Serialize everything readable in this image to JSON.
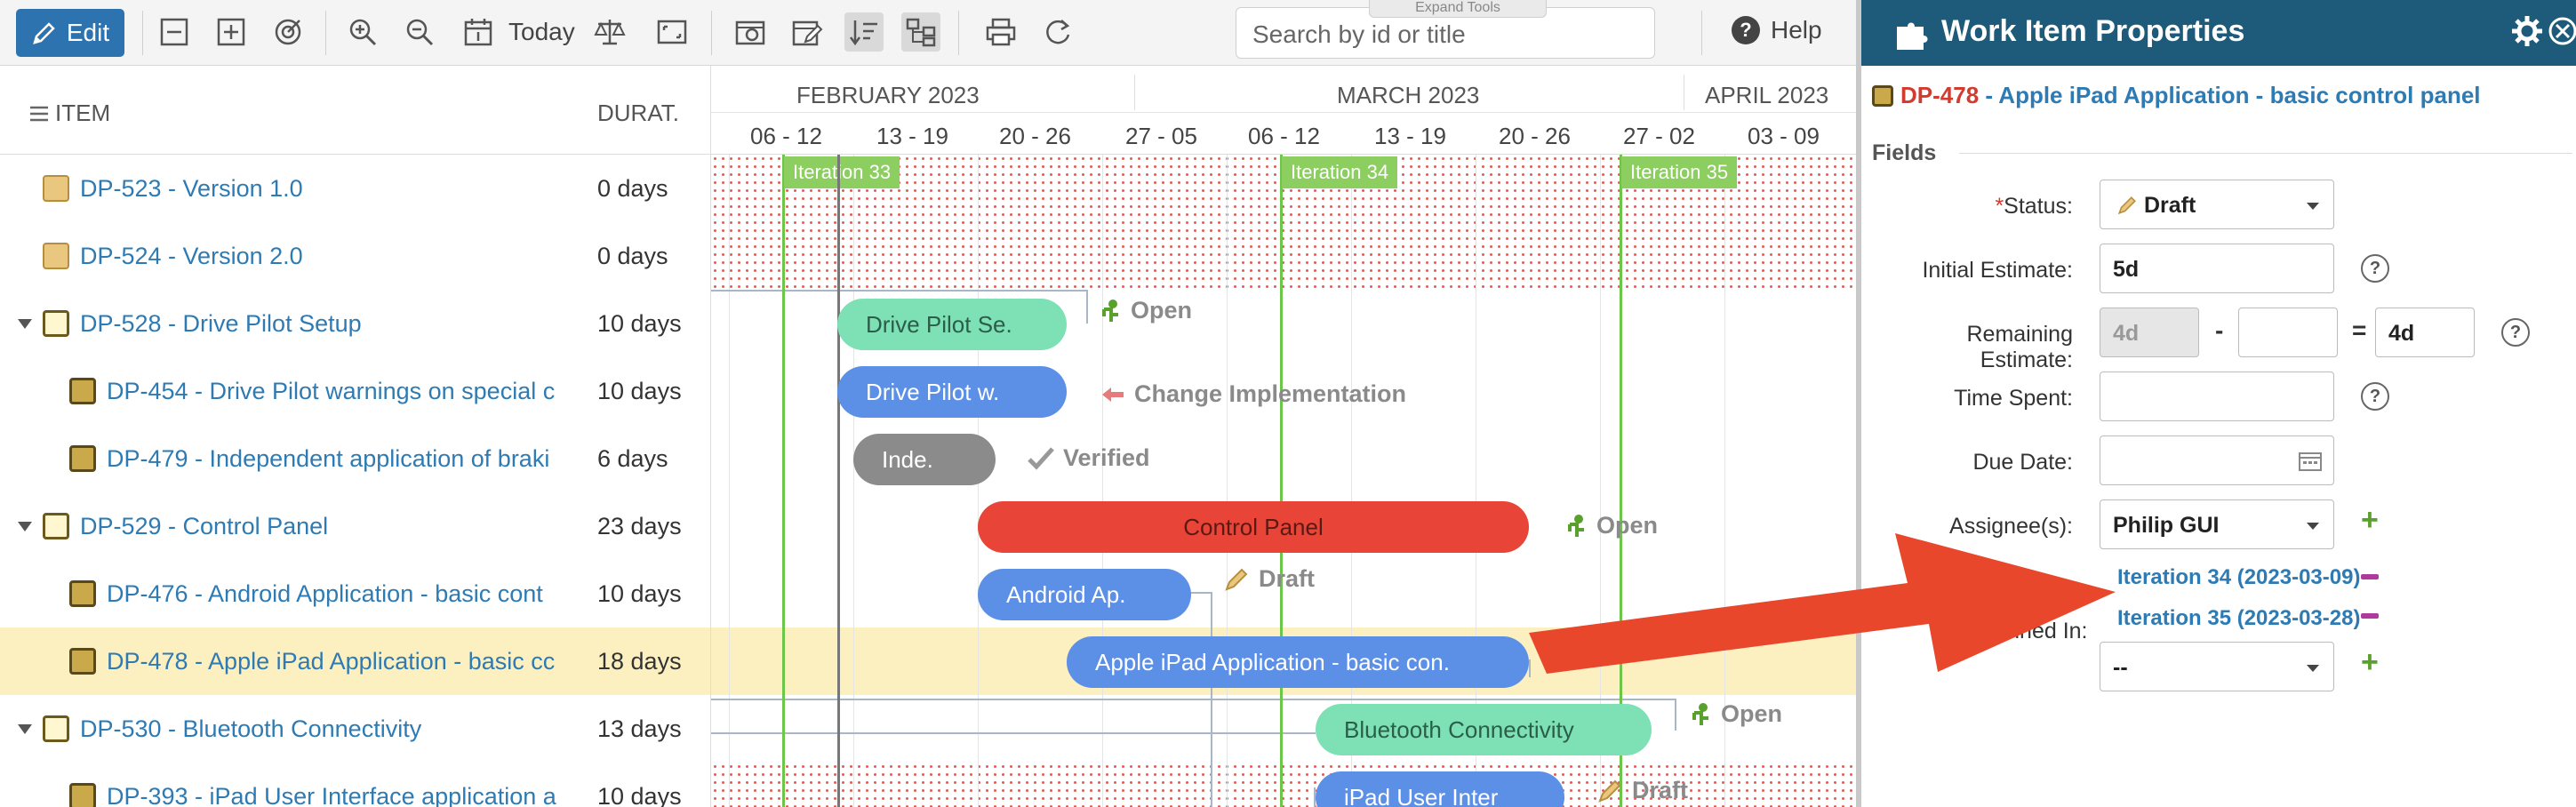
{
  "toolbar": {
    "edit_label": "Edit",
    "today_label": "Today",
    "search_placeholder": "Search by id or title",
    "expand_tools_label": "Expand Tools",
    "help_label": "Help"
  },
  "tree": {
    "col_item": "ITEM",
    "col_duration": "DURAT.",
    "rows": [
      {
        "label": "DP-523 - Version 1.0",
        "duration": "0 days"
      },
      {
        "label": "DP-524 - Version 2.0",
        "duration": "0 days"
      },
      {
        "label": "DP-528 - Drive Pilot Setup",
        "duration": "10 days"
      },
      {
        "label": "DP-454 - Drive Pilot warnings on special c",
        "duration": "10 days"
      },
      {
        "label": "DP-479 - Independent application of braki",
        "duration": "6 days"
      },
      {
        "label": "DP-529 - Control Panel",
        "duration": "23 days"
      },
      {
        "label": "DP-476 - Android Application - basic cont",
        "duration": "10 days"
      },
      {
        "label": "DP-478 - Apple iPad Application - basic cc",
        "duration": "18 days"
      },
      {
        "label": "DP-530 - Bluetooth Connectivity",
        "duration": "13 days"
      },
      {
        "label": "DP-393 - iPad User Interface application a",
        "duration": "10 days"
      }
    ]
  },
  "gantt": {
    "months": [
      "FEBRUARY 2023",
      "MARCH 2023",
      "APRIL 2023"
    ],
    "weeks": [
      "06 - 12",
      "13 - 19",
      "20 - 26",
      "27 - 05",
      "06 - 12",
      "13 - 19",
      "20 - 26",
      "27 - 02",
      "03 - 09"
    ],
    "iterations": [
      "Iteration 33",
      "Iteration 34",
      "Iteration 35"
    ],
    "bars": {
      "drive_pilot_setup": "Drive Pilot Se.",
      "drive_pilot_warnings": "Drive Pilot w.",
      "independent": "Inde.",
      "control_panel": "Control Panel",
      "android": "Android Ap.",
      "ipad": "Apple iPad Application - basic con.",
      "bluetooth": "Bluetooth Connectivity",
      "ipad_ui": "iPad User Inter"
    },
    "statuses": {
      "drive_pilot_setup": "Open",
      "drive_pilot_warnings": "Change Implementation",
      "independent": "Verified",
      "control_panel": "Open",
      "android": "Draft",
      "bluetooth": "Open",
      "ipad_ui": "Draft"
    }
  },
  "panel": {
    "title": "Work Item Properties",
    "item_id": "DP-478",
    "item_title": " - Apple iPad Application - basic control panel",
    "fields_section": "Fields",
    "status_label": "Status:",
    "status_value": "Draft",
    "initial_estimate_label": "Initial Estimate:",
    "initial_estimate_value": "5d",
    "remaining_estimate_label": "Remaining Estimate:",
    "remaining_a": "4d",
    "remaining_b": "",
    "remaining_result": "4d",
    "time_spent_label": "Time Spent:",
    "time_spent_value": "",
    "due_date_label": "Due Date:",
    "due_date_value": "",
    "assignee_label": "Assignee(s):",
    "assignee_value": "Philip GUI",
    "planned_in_label": "Planned In:",
    "planned_in": [
      "Iteration 34 (2023-03-09)",
      "Iteration 35 (2023-03-28)"
    ],
    "planned_in_select": "--",
    "minus_symbol": "-",
    "equals_symbol": "=",
    "help_symbol": "?"
  },
  "colors": {
    "panel_header": "#1e5a79",
    "edit_button": "#2c73b0",
    "link": "#2e7bb4",
    "id_red": "#d23b2e",
    "arrow": "#e8472c"
  }
}
